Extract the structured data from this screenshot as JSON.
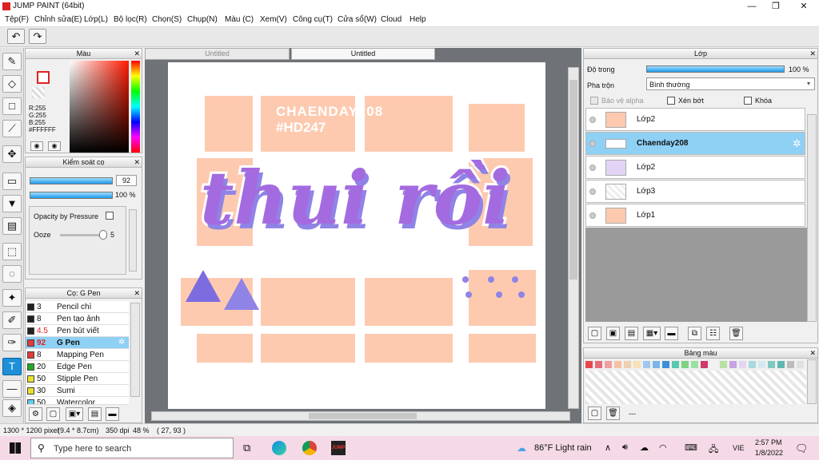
{
  "app": {
    "title": "JUMP PAINT (64bit)"
  },
  "window_controls": {
    "minimize": "—",
    "maximize": "❐",
    "close": "✕"
  },
  "menu": [
    "Tệp(F)",
    "Chỉnh sửa(E)",
    "Lớp(L)",
    "Bộ lọc(R)",
    "Chọn(S)",
    "Chụp(N)",
    "Màu (C)",
    "Xem(V)",
    "Công cụ(T)",
    "Cửa sổ(W)",
    "Cloud",
    "Help"
  ],
  "color_panel": {
    "title": "Màu",
    "r": "R:255",
    "g": "G:255",
    "b": "B:255",
    "hex": "#FFFFFF"
  },
  "brush_control": {
    "title": "Kiểm soát cọ",
    "size": "92",
    "opacity": "100 %",
    "opacity_by_pressure": "Opacity by Pressure",
    "ooze_label": "Ooze",
    "ooze_value": "5"
  },
  "brush_list": {
    "title": "Cọ: G Pen",
    "items": [
      {
        "size": "3",
        "name": "Pencil chì",
        "color": "#222222"
      },
      {
        "size": "8",
        "name": "Pen tạo ảnh",
        "color": "#222222"
      },
      {
        "size": "4.5",
        "name": "Pen bút viết",
        "color": "#222222"
      },
      {
        "size": "92",
        "name": "G Pen",
        "color": "#e23a3a"
      },
      {
        "size": "8",
        "name": "Mapping Pen",
        "color": "#e23a3a"
      },
      {
        "size": "20",
        "name": "Edge Pen",
        "color": "#22aa22"
      },
      {
        "size": "50",
        "name": "Stipple Pen",
        "color": "#e8e030"
      },
      {
        "size": "30",
        "name": "Sumi",
        "color": "#e8e030"
      },
      {
        "size": "50",
        "name": "Watercolor",
        "color": "#66ccee"
      }
    ]
  },
  "tabs": [
    "Untitled",
    "Untitled"
  ],
  "canvas_text": {
    "watermark1": "CHAENDAY208",
    "watermark2": "#HD247",
    "main": "thui rồi"
  },
  "layer_panel": {
    "title": "Lớp",
    "opacity_label": "Độ trong",
    "opacity_value": "100 %",
    "opacity_fraction": 1.0,
    "blend_label": "Pha trộn",
    "blend_value": "Bình thường",
    "protect_alpha": "Bảo vệ alpha",
    "clipping": "Xén bớt",
    "lock": "Khóa",
    "layers": [
      {
        "name": "Lớp2",
        "selected": false
      },
      {
        "name": "Chaenday208",
        "selected": true
      },
      {
        "name": "Lớp2",
        "selected": false
      },
      {
        "name": "Lớp3",
        "selected": false
      },
      {
        "name": "Lớp1",
        "selected": false
      }
    ]
  },
  "palette_panel": {
    "title": "Bảng màu",
    "footer": "---"
  },
  "status": {
    "size": "1300 * 1200 pixel",
    "dims": "(9.4 * 8.7cm)",
    "dpi": "350 dpi",
    "zoom": "48 %",
    "coord": "( 27, 93 )"
  },
  "taskbar": {
    "search_placeholder": "Type here to search",
    "weather": "86°F  Light rain",
    "lang": "VIE",
    "time": "2:57 PM",
    "date": "1/8/2022"
  },
  "colors": {
    "accent": "#1e90d9",
    "tile": "#fdcab0",
    "lettering": "#a46be0"
  }
}
